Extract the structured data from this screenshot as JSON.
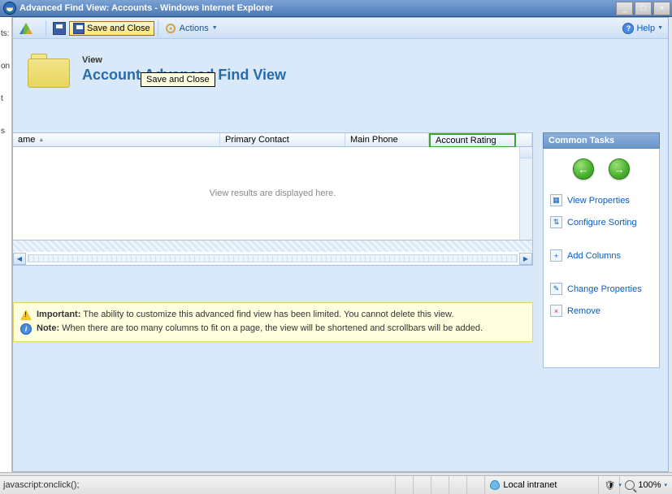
{
  "window": {
    "title": "Advanced Find View: Accounts - Windows Internet Explorer"
  },
  "toolbar": {
    "save_close_label": "Save and Close",
    "actions_label": "Actions",
    "help_label": "Help"
  },
  "tooltip": {
    "text": "Save and Close"
  },
  "header": {
    "small_label": "View",
    "title": "Account Advanced Find View"
  },
  "grid": {
    "columns": {
      "name": "ame",
      "primary_contact": "Primary Contact",
      "main_phone": "Main Phone",
      "account_rating": "Account Rating"
    },
    "empty_message": "View results are displayed here."
  },
  "messages": {
    "important_label": "Important:",
    "important_text": "The ability to customize this advanced find view has been limited. You cannot delete this view.",
    "note_label": "Note:",
    "note_text": "When there are too many columns to fit on a page, the view will be shortened and scrollbars will be added."
  },
  "tasks": {
    "panel_title": "Common Tasks",
    "view_properties": "View Properties",
    "configure_sorting": "Configure Sorting",
    "add_columns": "Add Columns",
    "change_properties": "Change Properties",
    "remove": "Remove"
  },
  "statusbar": {
    "address": "javascript:onclick();",
    "zone": "Local intranet",
    "zoom": "100%"
  }
}
